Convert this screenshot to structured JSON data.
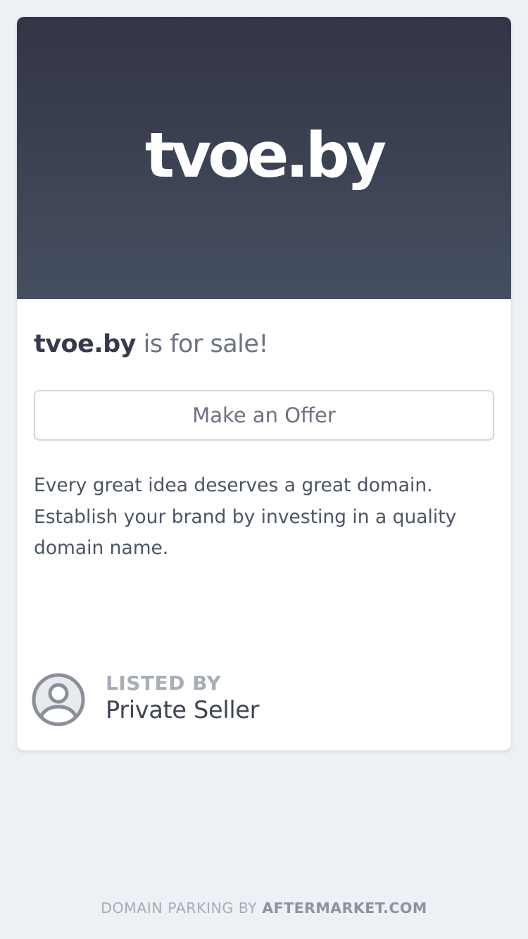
{
  "hero": {
    "domain": "tvoe.by"
  },
  "heading": {
    "domain": "tvoe.by",
    "suffix": " is for sale!"
  },
  "offer_button": {
    "label": "Make an Offer"
  },
  "description": "Every great idea deserves a great domain. Establish your brand by investing in a quality domain name.",
  "seller": {
    "listed_by_label": "LISTED BY",
    "name": "Private Seller",
    "icon": "user-avatar-icon"
  },
  "footer": {
    "prefix": "DOMAIN PARKING BY ",
    "brand": "AFTERMARKET.COM"
  },
  "colors": {
    "page_background": "#edf0f4",
    "hero_gradient_top": "#323545",
    "hero_gradient_bottom": "#454f61",
    "heading_dark": "#353a4d",
    "text_gray": "#6b7280"
  }
}
